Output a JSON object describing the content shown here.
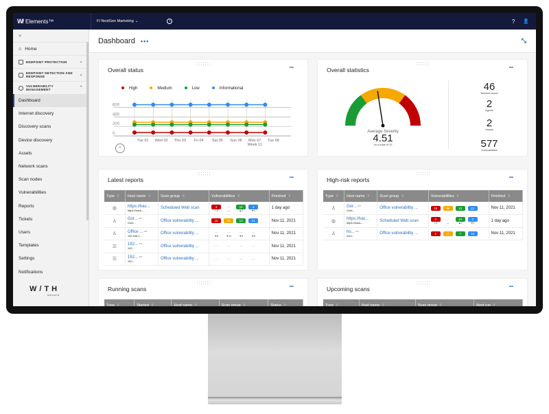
{
  "topbar": {
    "brand_mark": "W/",
    "brand_name": "Elements™",
    "org": "FI NextGen Marketing",
    "org_chevron": "⌄",
    "info_icon": "i",
    "help_icon": "?",
    "user_icon": "👤"
  },
  "sidebar": {
    "collapse_icon": "«",
    "home": "Home",
    "groups": [
      {
        "label": "ENDPOINT PROTECTION",
        "chevron": "⌄"
      },
      {
        "label": "ENDPOINT DETECTION AND RESPONSE",
        "chevron": "⌄"
      },
      {
        "label": "VULNERABILITY MANAGEMENT",
        "chevron": "⌃"
      }
    ],
    "items": [
      "Dashboard",
      "Internet discovery",
      "Discovery scans",
      "Device discovery",
      "Assets",
      "Network scans",
      "Scan nodes",
      "Vulnerabilities",
      "Reports",
      "Tickets",
      "Users",
      "Templates",
      "Settings",
      "Notifications"
    ],
    "active_item": "Dashboard",
    "logo_word": "W/TH",
    "logo_sub": "secure"
  },
  "header": {
    "title": "Dashboard",
    "more": "•••",
    "shrink_icon": "⤡"
  },
  "overall_status": {
    "title": "Overall status",
    "more": "•••",
    "back_icon": "<",
    "chart_data": {
      "type": "line",
      "x": [
        "Tue 01",
        "Wed 02",
        "Thu 03",
        "Fri 04",
        "Sat 05",
        "Sun 06",
        "Mon 07",
        "Tue 08"
      ],
      "x_sublabel": {
        "Mon 07": "Week 11"
      },
      "yticks": [
        0,
        200,
        400,
        600
      ],
      "ylim": [
        0,
        650
      ],
      "series": [
        {
          "name": "High",
          "color": "#c00000",
          "values": [
            15,
            15,
            15,
            15,
            15,
            15,
            15,
            15
          ]
        },
        {
          "name": "Medium",
          "color": "#f5a800",
          "values": [
            230,
            230,
            230,
            230,
            230,
            230,
            230,
            230
          ]
        },
        {
          "name": "Low",
          "color": "#1a9c34",
          "values": [
            180,
            180,
            180,
            180,
            180,
            180,
            180,
            180
          ]
        },
        {
          "name": "Informational",
          "color": "#2f8cf0",
          "values": [
            600,
            600,
            600,
            600,
            600,
            600,
            600,
            600
          ]
        }
      ]
    }
  },
  "overall_statistics": {
    "title": "Overall statistics",
    "more": "•••",
    "gauge": {
      "label": "Average Severity",
      "value": "4.51",
      "scale": "on a scale of 10",
      "fraction": 0.451
    },
    "stats": [
      {
        "value": "46",
        "label": "Network scans"
      },
      {
        "value": "2",
        "label": "Agents"
      },
      {
        "value": "2",
        "label": "Assets"
      },
      {
        "value": "577",
        "label": "Vulnerabilities"
      }
    ]
  },
  "latest_reports": {
    "title": "Latest reports",
    "more": "•••",
    "columns": [
      "Type",
      "Host name",
      "Scan group",
      "Vulnerabilities",
      "Finished"
    ],
    "rows": [
      {
        "type": "globe",
        "host": "https://hac...",
        "host_sub": "https://hack-...",
        "group": "Scheduled Web scan",
        "vulns": [
          "4",
          "—",
          "10",
          "4"
        ],
        "trend": [
          "+-0",
          "—",
          "▲2",
          "▼1"
        ],
        "finished": "1 day ago"
      },
      {
        "type": "linux",
        "host": "Gor...",
        "host_sub": "Goril...",
        "group": "Office vulnerability ...",
        "vulns": [
          "15",
          "38",
          "13",
          "21"
        ],
        "trend": [
          "",
          "",
          "",
          ""
        ],
        "finished": "Nov 11, 2021"
      },
      {
        "type": "linux",
        "host": "Office ...",
        "host_sub": "192.168.1...",
        "group": "Office vulnerability ...",
        "vulns": [
          "—",
          "—",
          "—",
          "—"
        ],
        "trend": [
          "▼8",
          "▼14",
          "▼5",
          "▼6"
        ],
        "finished": "Nov 11, 2021"
      },
      {
        "type": "server",
        "host": "192...",
        "host_sub": "192...",
        "group": "Office vulnerability ...",
        "vulns": [
          "—",
          "—",
          "—",
          "—"
        ],
        "trend": [
          "",
          "",
          "",
          ""
        ],
        "finished": "Nov 11, 2021"
      },
      {
        "type": "server",
        "host": "192...",
        "host_sub": "192...",
        "group": "Office vulnerability ...",
        "vulns": [
          "—",
          "—",
          "—",
          "—"
        ],
        "trend": [
          "",
          "",
          "",
          ""
        ],
        "finished": "Nov 11, 2021"
      }
    ]
  },
  "high_risk_reports": {
    "title": "High-risk reports",
    "more": "•••",
    "columns": [
      "Type",
      "Host name",
      "Scan group",
      "Vulnerabilities",
      "Finished"
    ],
    "rows": [
      {
        "type": "linux",
        "host": "Gor...",
        "host_sub": "Goril...",
        "group": "Office vulnerability ...",
        "vulns": [
          "15",
          "38",
          "13",
          "21"
        ],
        "trend": [
          "",
          "",
          "",
          ""
        ],
        "finished": "Nov 11, 2021"
      },
      {
        "type": "globe",
        "host": "https://hac...",
        "host_sub": "https://hack-...",
        "group": "Scheduled Web scan",
        "vulns": [
          "4",
          "—",
          "10",
          "4"
        ],
        "trend": [
          "+-0",
          "—",
          "▲2",
          "▼1"
        ],
        "finished": "1 day ago"
      },
      {
        "type": "linux",
        "host": "ho...",
        "host_sub": "hom...",
        "group": "Office vulnerability ...",
        "vulns": [
          "2",
          "8",
          "7",
          "14"
        ],
        "trend": [
          "",
          "",
          "",
          ""
        ],
        "finished": "Nov 11, 2021"
      }
    ]
  },
  "running_scans": {
    "title": "Running scans",
    "more": "•••",
    "columns": [
      "Type",
      "Started",
      "Host name",
      "Scan group",
      "Status"
    ]
  },
  "upcoming_scans": {
    "title": "Upcoming scans",
    "more": "•••",
    "columns": [
      "Type",
      "Host name",
      "Scan group",
      "Next run"
    ]
  },
  "colors": {
    "high": "#c00000",
    "medium": "#f5a800",
    "low": "#1a9c34",
    "info": "#2f8cf0",
    "topbar": "#141a3c",
    "accent": "#2a6ebc"
  }
}
